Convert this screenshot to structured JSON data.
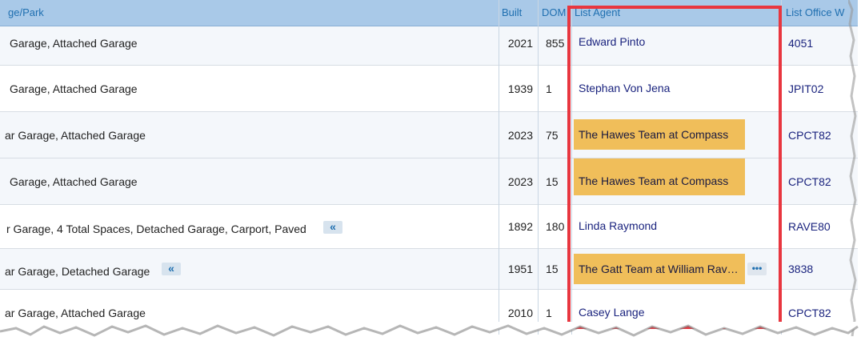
{
  "columns": {
    "park": "ge/Park",
    "built": "Built",
    "dom": "DOM",
    "agent": "List Agent",
    "office": "List Office W"
  },
  "rows": [
    {
      "park": "Garage, Attached Garage",
      "built": "2021",
      "dom": "855",
      "agent": "Edward Pinto",
      "office": "4051",
      "highlight": false
    },
    {
      "park": "Garage, Attached Garage",
      "built": "1939",
      "dom": "1",
      "agent": "Stephan Von Jena",
      "office": "JPIT02",
      "highlight": false
    },
    {
      "park": "ar Garage, Attached Garage",
      "built": "2023",
      "dom": "75",
      "agent": "The Hawes Team at Compass",
      "office": "CPCT82",
      "highlight": true
    },
    {
      "park": "Garage, Attached Garage",
      "built": "2023",
      "dom": "15",
      "agent": "The Hawes Team at Compass",
      "office": "CPCT82",
      "highlight": true
    },
    {
      "park": "r Garage, 4 Total Spaces, Detached Garage, Carport, Paved",
      "built": "1892",
      "dom": "180",
      "agent": "Linda Raymond",
      "office": "RAVE80",
      "highlight": false
    },
    {
      "park": "ar Garage, Detached Garage",
      "built": "1951",
      "dom": "15",
      "agent": "The Gatt Team at William Rav…",
      "office": "3838",
      "highlight": true
    },
    {
      "park": "ar Garage, Attached Garage",
      "built": "2010",
      "dom": "1",
      "agent": "Casey Lange",
      "office": "CPCT82",
      "highlight": false
    }
  ],
  "icons": {
    "expand": "«",
    "more": "•••"
  },
  "colors": {
    "header_bg": "#a9c9e8",
    "highlight": "#f0be5a",
    "annotation_box": "#e8363f",
    "link": "#1a237e"
  }
}
